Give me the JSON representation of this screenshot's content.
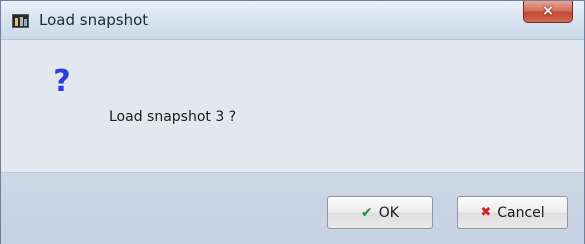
{
  "window": {
    "title": "Load snapshot",
    "close_symbol": "×"
  },
  "dialog": {
    "icon": "question-icon",
    "icon_glyph": "?",
    "message": "Load snapshot 3 ?"
  },
  "buttons": {
    "ok": {
      "label": "OK",
      "icon": "check-icon",
      "icon_glyph": "✔"
    },
    "cancel": {
      "label": "Cancel",
      "icon": "cross-icon",
      "icon_glyph": "✖"
    }
  },
  "colors": {
    "question_icon": "#2b3fe0",
    "ok_icon": "#2e8b2e",
    "cancel_icon": "#d32020",
    "close_button": "#c24a36"
  }
}
